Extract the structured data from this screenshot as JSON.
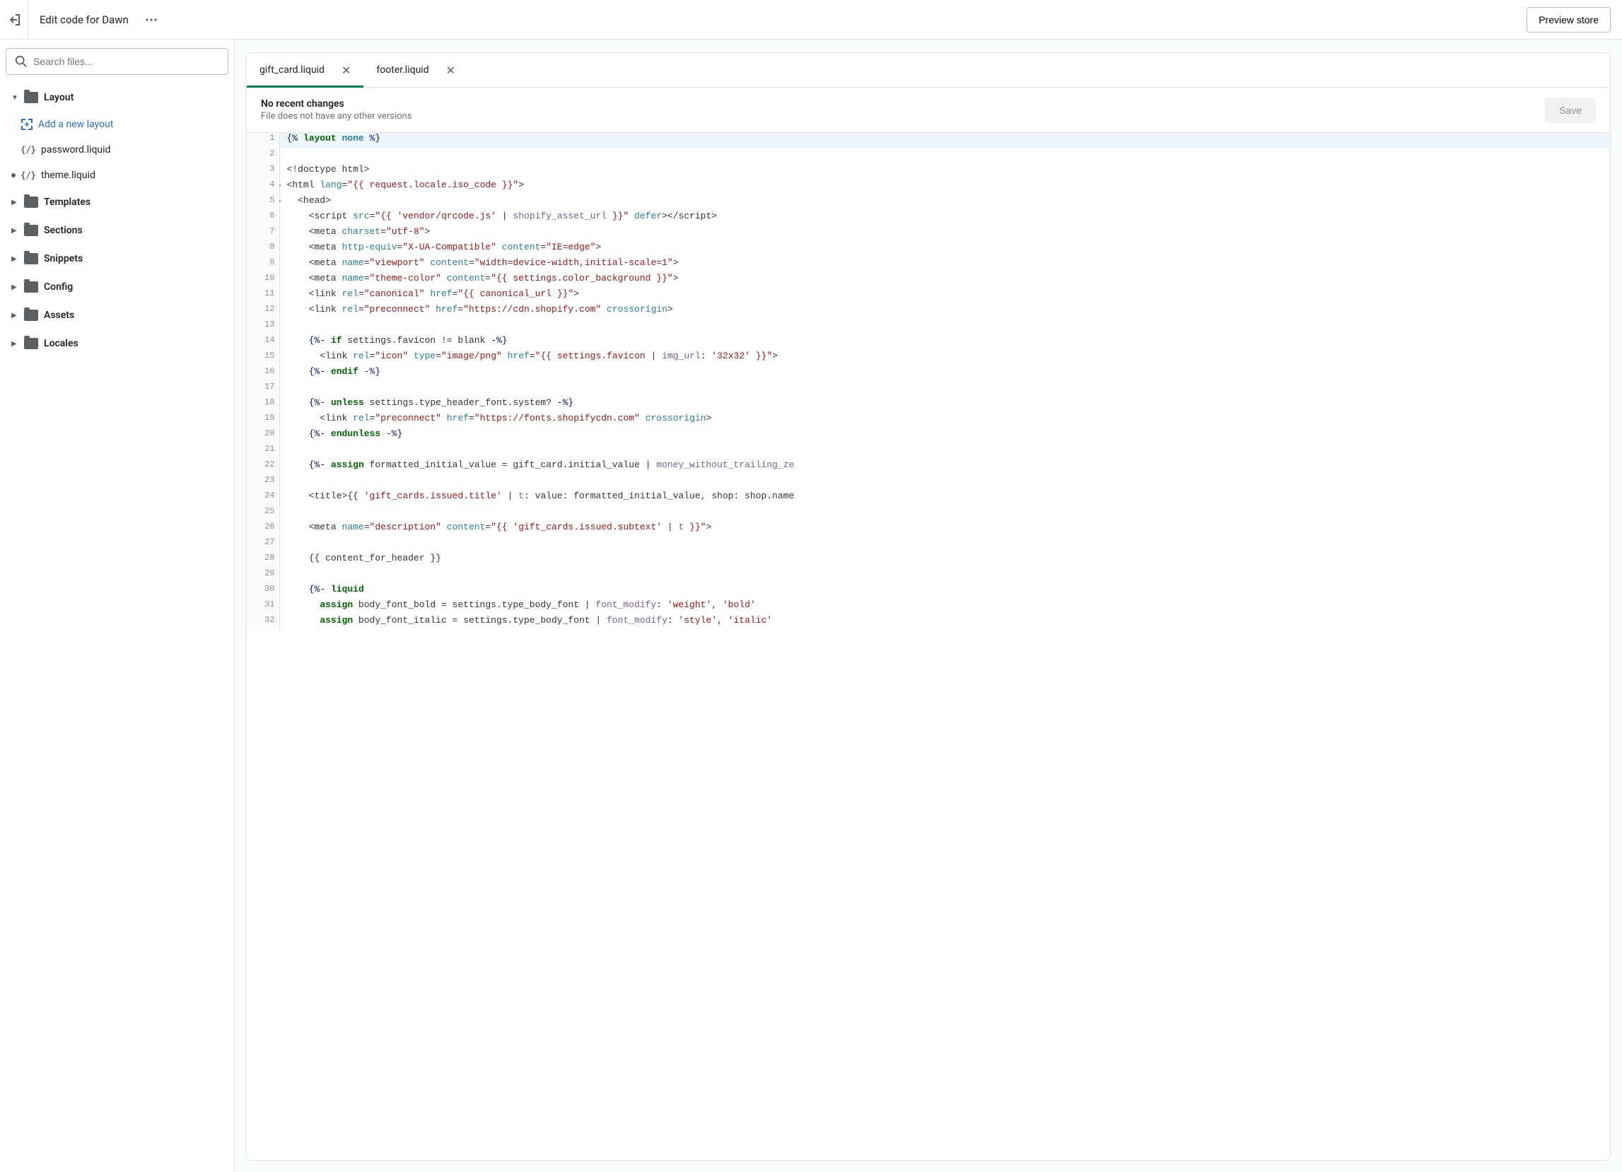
{
  "header": {
    "title": "Edit code for Dawn",
    "preview_label": "Preview store"
  },
  "search": {
    "placeholder": "Search files..."
  },
  "sidebar": {
    "folders": [
      {
        "name": "Layout",
        "expanded": true,
        "add_action": "Add a new layout",
        "files": [
          {
            "name": "password.liquid",
            "modified": false
          },
          {
            "name": "theme.liquid",
            "modified": true
          }
        ]
      },
      {
        "name": "Templates",
        "expanded": false
      },
      {
        "name": "Sections",
        "expanded": false
      },
      {
        "name": "Snippets",
        "expanded": false
      },
      {
        "name": "Config",
        "expanded": false
      },
      {
        "name": "Assets",
        "expanded": false
      },
      {
        "name": "Locales",
        "expanded": false
      }
    ]
  },
  "tabs": [
    {
      "label": "gift_card.liquid",
      "active": true
    },
    {
      "label": "footer.liquid",
      "active": false
    }
  ],
  "status": {
    "title": "No recent changes",
    "subtitle": "File does not have any other versions",
    "save_label": "Save"
  },
  "code": [
    {
      "n": 1,
      "hl": true,
      "tokens": [
        {
          "t": "{% ",
          "c": "tok-liq"
        },
        {
          "t": "layout",
          "c": "tok-kw"
        },
        {
          "t": " none",
          "c": "tok-kw2"
        },
        {
          "t": " %}",
          "c": "tok-liq"
        }
      ]
    },
    {
      "n": 2,
      "tokens": []
    },
    {
      "n": 3,
      "tokens": [
        {
          "t": "<!doctype html>",
          "c": "tok-gray"
        }
      ]
    },
    {
      "n": 4,
      "fold": true,
      "tokens": [
        {
          "t": "<html ",
          "c": "tok-gray"
        },
        {
          "t": "lang",
          "c": "tok-attr"
        },
        {
          "t": "=",
          "c": "tok-gray"
        },
        {
          "t": "\"{{ request.locale.iso_code }}\"",
          "c": "tok-str"
        },
        {
          "t": ">",
          "c": "tok-gray"
        }
      ]
    },
    {
      "n": 5,
      "fold": true,
      "tokens": [
        {
          "t": "  <head>",
          "c": "tok-gray"
        }
      ]
    },
    {
      "n": 6,
      "tokens": [
        {
          "t": "    <script ",
          "c": "tok-gray"
        },
        {
          "t": "src",
          "c": "tok-attr"
        },
        {
          "t": "=",
          "c": "tok-gray"
        },
        {
          "t": "\"{{ ",
          "c": "tok-str"
        },
        {
          "t": "'vendor/qrcode.js'",
          "c": "tok-str"
        },
        {
          "t": " | ",
          "c": "tok-gray"
        },
        {
          "t": "shopify_asset_url",
          "c": "tok-filter"
        },
        {
          "t": " }}\"",
          "c": "tok-str"
        },
        {
          "t": " defer",
          "c": "tok-attr"
        },
        {
          "t": "></script>",
          "c": "tok-gray"
        }
      ]
    },
    {
      "n": 7,
      "tokens": [
        {
          "t": "    <meta ",
          "c": "tok-gray"
        },
        {
          "t": "charset",
          "c": "tok-attr"
        },
        {
          "t": "=",
          "c": "tok-gray"
        },
        {
          "t": "\"utf-8\"",
          "c": "tok-str"
        },
        {
          "t": ">",
          "c": "tok-gray"
        }
      ]
    },
    {
      "n": 8,
      "tokens": [
        {
          "t": "    <meta ",
          "c": "tok-gray"
        },
        {
          "t": "http-equiv",
          "c": "tok-attr"
        },
        {
          "t": "=",
          "c": "tok-gray"
        },
        {
          "t": "\"X-UA-Compatible\"",
          "c": "tok-str"
        },
        {
          "t": " ",
          "c": ""
        },
        {
          "t": "content",
          "c": "tok-attr"
        },
        {
          "t": "=",
          "c": "tok-gray"
        },
        {
          "t": "\"IE=edge\"",
          "c": "tok-str"
        },
        {
          "t": ">",
          "c": "tok-gray"
        }
      ]
    },
    {
      "n": 9,
      "tokens": [
        {
          "t": "    <meta ",
          "c": "tok-gray"
        },
        {
          "t": "name",
          "c": "tok-attr"
        },
        {
          "t": "=",
          "c": "tok-gray"
        },
        {
          "t": "\"viewport\"",
          "c": "tok-str"
        },
        {
          "t": " ",
          "c": ""
        },
        {
          "t": "content",
          "c": "tok-attr"
        },
        {
          "t": "=",
          "c": "tok-gray"
        },
        {
          "t": "\"width=device-width,initial-scale=1\"",
          "c": "tok-str"
        },
        {
          "t": ">",
          "c": "tok-gray"
        }
      ]
    },
    {
      "n": 10,
      "tokens": [
        {
          "t": "    <meta ",
          "c": "tok-gray"
        },
        {
          "t": "name",
          "c": "tok-attr"
        },
        {
          "t": "=",
          "c": "tok-gray"
        },
        {
          "t": "\"theme-color\"",
          "c": "tok-str"
        },
        {
          "t": " ",
          "c": ""
        },
        {
          "t": "content",
          "c": "tok-attr"
        },
        {
          "t": "=",
          "c": "tok-gray"
        },
        {
          "t": "\"{{ settings.color_background }}\"",
          "c": "tok-str"
        },
        {
          "t": ">",
          "c": "tok-gray"
        }
      ]
    },
    {
      "n": 11,
      "tokens": [
        {
          "t": "    <link ",
          "c": "tok-gray"
        },
        {
          "t": "rel",
          "c": "tok-attr"
        },
        {
          "t": "=",
          "c": "tok-gray"
        },
        {
          "t": "\"canonical\"",
          "c": "tok-str"
        },
        {
          "t": " ",
          "c": ""
        },
        {
          "t": "href",
          "c": "tok-attr"
        },
        {
          "t": "=",
          "c": "tok-gray"
        },
        {
          "t": "\"{{ canonical_url }}\"",
          "c": "tok-str"
        },
        {
          "t": ">",
          "c": "tok-gray"
        }
      ]
    },
    {
      "n": 12,
      "tokens": [
        {
          "t": "    <link ",
          "c": "tok-gray"
        },
        {
          "t": "rel",
          "c": "tok-attr"
        },
        {
          "t": "=",
          "c": "tok-gray"
        },
        {
          "t": "\"preconnect\"",
          "c": "tok-str"
        },
        {
          "t": " ",
          "c": ""
        },
        {
          "t": "href",
          "c": "tok-attr"
        },
        {
          "t": "=",
          "c": "tok-gray"
        },
        {
          "t": "\"https://cdn.shopify.com\"",
          "c": "tok-str"
        },
        {
          "t": " crossorigin",
          "c": "tok-attr"
        },
        {
          "t": ">",
          "c": "tok-gray"
        }
      ]
    },
    {
      "n": 13,
      "tokens": []
    },
    {
      "n": 14,
      "tokens": [
        {
          "t": "    ",
          "c": ""
        },
        {
          "t": "{%- ",
          "c": "tok-liq"
        },
        {
          "t": "if",
          "c": "tok-kw"
        },
        {
          "t": " settings.favicon != blank ",
          "c": "tok-gray"
        },
        {
          "t": "-%}",
          "c": "tok-liq"
        }
      ]
    },
    {
      "n": 15,
      "tokens": [
        {
          "t": "      <link ",
          "c": "tok-gray"
        },
        {
          "t": "rel",
          "c": "tok-attr"
        },
        {
          "t": "=",
          "c": "tok-gray"
        },
        {
          "t": "\"icon\"",
          "c": "tok-str"
        },
        {
          "t": " ",
          "c": ""
        },
        {
          "t": "type",
          "c": "tok-attr"
        },
        {
          "t": "=",
          "c": "tok-gray"
        },
        {
          "t": "\"image/png\"",
          "c": "tok-str"
        },
        {
          "t": " ",
          "c": ""
        },
        {
          "t": "href",
          "c": "tok-attr"
        },
        {
          "t": "=",
          "c": "tok-gray"
        },
        {
          "t": "\"{{ settings.favicon | ",
          "c": "tok-str"
        },
        {
          "t": "img_url",
          "c": "tok-filter"
        },
        {
          "t": ": ",
          "c": "tok-gray"
        },
        {
          "t": "'32x32'",
          "c": "tok-str"
        },
        {
          "t": " }}\"",
          "c": "tok-str"
        },
        {
          "t": ">",
          "c": "tok-gray"
        }
      ]
    },
    {
      "n": 16,
      "tokens": [
        {
          "t": "    ",
          "c": ""
        },
        {
          "t": "{%- ",
          "c": "tok-liq"
        },
        {
          "t": "endif",
          "c": "tok-kw"
        },
        {
          "t": " -%}",
          "c": "tok-liq"
        }
      ]
    },
    {
      "n": 17,
      "tokens": []
    },
    {
      "n": 18,
      "tokens": [
        {
          "t": "    ",
          "c": ""
        },
        {
          "t": "{%- ",
          "c": "tok-liq"
        },
        {
          "t": "unless",
          "c": "tok-kw"
        },
        {
          "t": " settings.type_header_font.system? ",
          "c": "tok-gray"
        },
        {
          "t": "-%}",
          "c": "tok-liq"
        }
      ]
    },
    {
      "n": 19,
      "tokens": [
        {
          "t": "      <link ",
          "c": "tok-gray"
        },
        {
          "t": "rel",
          "c": "tok-attr"
        },
        {
          "t": "=",
          "c": "tok-gray"
        },
        {
          "t": "\"preconnect\"",
          "c": "tok-str"
        },
        {
          "t": " ",
          "c": ""
        },
        {
          "t": "href",
          "c": "tok-attr"
        },
        {
          "t": "=",
          "c": "tok-gray"
        },
        {
          "t": "\"https://fonts.shopifycdn.com\"",
          "c": "tok-str"
        },
        {
          "t": " crossorigin",
          "c": "tok-attr"
        },
        {
          "t": ">",
          "c": "tok-gray"
        }
      ]
    },
    {
      "n": 20,
      "tokens": [
        {
          "t": "    ",
          "c": ""
        },
        {
          "t": "{%- ",
          "c": "tok-liq"
        },
        {
          "t": "endunless",
          "c": "tok-kw"
        },
        {
          "t": " -%}",
          "c": "tok-liq"
        }
      ]
    },
    {
      "n": 21,
      "tokens": []
    },
    {
      "n": 22,
      "tokens": [
        {
          "t": "    ",
          "c": ""
        },
        {
          "t": "{%- ",
          "c": "tok-liq"
        },
        {
          "t": "assign",
          "c": "tok-kw"
        },
        {
          "t": " formatted_initial_value = gift_card.initial_value | ",
          "c": "tok-gray"
        },
        {
          "t": "money_without_trailing_ze",
          "c": "tok-filter"
        }
      ]
    },
    {
      "n": 23,
      "tokens": []
    },
    {
      "n": 24,
      "tokens": [
        {
          "t": "    <title>{{ ",
          "c": "tok-gray"
        },
        {
          "t": "'gift_cards.issued.title'",
          "c": "tok-str"
        },
        {
          "t": " | ",
          "c": "tok-gray"
        },
        {
          "t": "t",
          "c": "tok-filter"
        },
        {
          "t": ": value: formatted_initial_value, shop: shop.name",
          "c": "tok-gray"
        }
      ]
    },
    {
      "n": 25,
      "tokens": []
    },
    {
      "n": 26,
      "tokens": [
        {
          "t": "    <meta ",
          "c": "tok-gray"
        },
        {
          "t": "name",
          "c": "tok-attr"
        },
        {
          "t": "=",
          "c": "tok-gray"
        },
        {
          "t": "\"description\"",
          "c": "tok-str"
        },
        {
          "t": " ",
          "c": ""
        },
        {
          "t": "content",
          "c": "tok-attr"
        },
        {
          "t": "=",
          "c": "tok-gray"
        },
        {
          "t": "\"{{ ",
          "c": "tok-str"
        },
        {
          "t": "'gift_cards.issued.subtext'",
          "c": "tok-str"
        },
        {
          "t": " | ",
          "c": "tok-gray"
        },
        {
          "t": "t",
          "c": "tok-filter"
        },
        {
          "t": " }}\"",
          "c": "tok-str"
        },
        {
          "t": ">",
          "c": "tok-gray"
        }
      ]
    },
    {
      "n": 27,
      "tokens": []
    },
    {
      "n": 28,
      "tokens": [
        {
          "t": "    {{ content_for_header }}",
          "c": "tok-gray"
        }
      ]
    },
    {
      "n": 29,
      "tokens": []
    },
    {
      "n": 30,
      "tokens": [
        {
          "t": "    ",
          "c": ""
        },
        {
          "t": "{%- ",
          "c": "tok-liq"
        },
        {
          "t": "liquid",
          "c": "tok-kw"
        }
      ]
    },
    {
      "n": 31,
      "tokens": [
        {
          "t": "      ",
          "c": ""
        },
        {
          "t": "assign",
          "c": "tok-kw"
        },
        {
          "t": " body_font_bold = settings.type_body_font | ",
          "c": "tok-gray"
        },
        {
          "t": "font_modify",
          "c": "tok-filter"
        },
        {
          "t": ": ",
          "c": "tok-gray"
        },
        {
          "t": "'weight'",
          "c": "tok-str"
        },
        {
          "t": ", ",
          "c": "tok-gray"
        },
        {
          "t": "'bold'",
          "c": "tok-str"
        }
      ]
    },
    {
      "n": 32,
      "tokens": [
        {
          "t": "      ",
          "c": ""
        },
        {
          "t": "assign",
          "c": "tok-kw"
        },
        {
          "t": " body_font_italic = settings.type_body_font | ",
          "c": "tok-gray"
        },
        {
          "t": "font_modify",
          "c": "tok-filter"
        },
        {
          "t": ": ",
          "c": "tok-gray"
        },
        {
          "t": "'style'",
          "c": "tok-str"
        },
        {
          "t": ", ",
          "c": "tok-gray"
        },
        {
          "t": "'italic'",
          "c": "tok-str"
        }
      ]
    }
  ]
}
